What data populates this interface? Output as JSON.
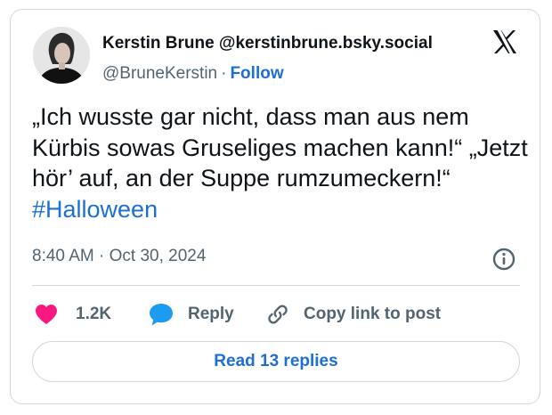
{
  "author": {
    "display_name": "Kerstin Brune @kerstinbrune.bsky.social",
    "handle": "@BruneKerstin",
    "separator": "·",
    "follow_label": "Follow"
  },
  "tweet": {
    "text": "„Ich wusste gar nicht, dass man aus nem Kürbis sowas Gruseliges machen kann!“ „Jetzt hör’ auf, an der Suppe rumzumeckern!“ ",
    "hashtag": "#Halloween",
    "time": "8:40 AM",
    "separator": "·",
    "date": "Oct 30, 2024"
  },
  "actions": {
    "like_count": "1.2K",
    "reply_label": "Reply",
    "copy_link_label": "Copy link to post",
    "read_replies_label": "Read 13 replies"
  },
  "icons": {
    "platform": "x-logo-icon",
    "like": "heart-icon",
    "reply": "speech-bubble-icon",
    "copy": "link-icon",
    "info": "info-icon"
  },
  "colors": {
    "link": "#1d6fd6",
    "like": "#f91880",
    "reply": "#1d9bf0",
    "muted": "#536471",
    "border": "#cfd9de"
  }
}
